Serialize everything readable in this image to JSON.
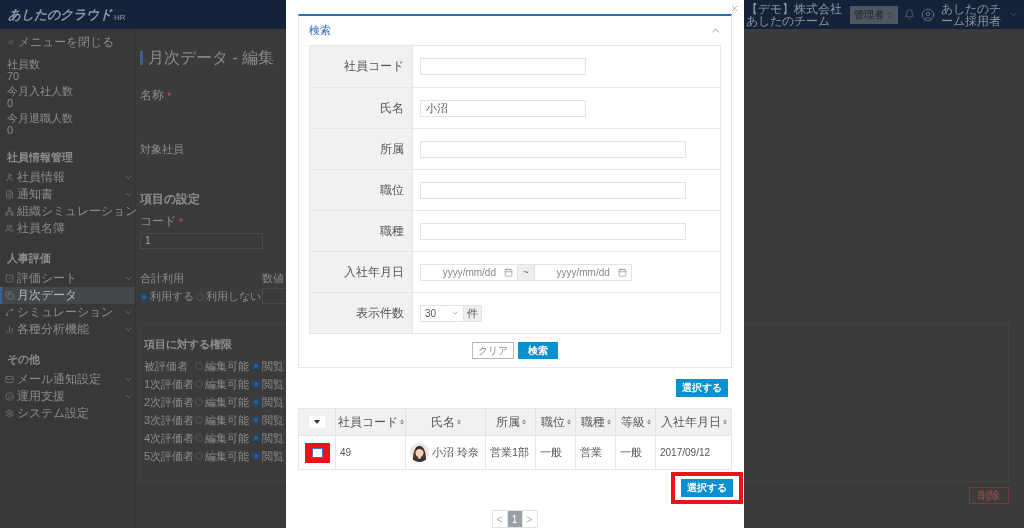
{
  "header": {
    "logo": "あしたのクラウド",
    "logo_suffix": "HR",
    "company": "【デモ】株式会社あしたのチーム",
    "role": "管理者",
    "user": "あしたのチーム採用者"
  },
  "sidebar": {
    "collapse": "メニューを閉じる",
    "stats": [
      {
        "label": "社員数",
        "value": "70"
      },
      {
        "label": "今月入社人数",
        "value": "0"
      },
      {
        "label": "今月退職人数",
        "value": "0"
      }
    ],
    "sections": [
      {
        "title": "社員情報管理",
        "items": [
          {
            "label": "社員情報",
            "expandable": true,
            "selected": false
          },
          {
            "label": "通知書",
            "expandable": true,
            "selected": false
          },
          {
            "label": "組織シミュレーション",
            "expandable": false,
            "selected": false
          },
          {
            "label": "社員名簿",
            "expandable": false,
            "selected": false
          }
        ]
      },
      {
        "title": "人事評価",
        "items": [
          {
            "label": "評価シート",
            "expandable": true,
            "selected": false
          },
          {
            "label": "月次データ",
            "expandable": false,
            "selected": true
          },
          {
            "label": "シミュレーション",
            "expandable": true,
            "selected": false
          },
          {
            "label": "各種分析機能",
            "expandable": true,
            "selected": false
          }
        ]
      },
      {
        "title": "その他",
        "items": [
          {
            "label": "メール通知設定",
            "expandable": true,
            "selected": false
          },
          {
            "label": "運用支援",
            "expandable": true,
            "selected": false
          },
          {
            "label": "システム設定",
            "expandable": false,
            "selected": false
          }
        ]
      }
    ]
  },
  "page": {
    "title": "月次データ - 編集",
    "name_field": {
      "label": "名称",
      "required_mark": "*"
    },
    "target_label": "対象社員",
    "settings_title": "項目の設定",
    "code_field": {
      "label": "コード",
      "required_mark": "*",
      "value": "1"
    },
    "total_label": "合計利用",
    "total_options": [
      {
        "label": "利用する",
        "selected": true
      },
      {
        "label": "利用しない",
        "selected": false
      }
    ],
    "numeric_label": "数値",
    "permissions_title": "項目に対する権限",
    "permissions": [
      {
        "role": "被評価者",
        "options": [
          {
            "label": "編集可能",
            "selected": false
          },
          {
            "label": "閲覧",
            "selected": true
          }
        ]
      },
      {
        "role": "1次評価者",
        "options": [
          {
            "label": "編集可能",
            "selected": false
          },
          {
            "label": "閲覧",
            "selected": true
          }
        ]
      },
      {
        "role": "2次評価者",
        "options": [
          {
            "label": "編集可能",
            "selected": false
          },
          {
            "label": "閲覧",
            "selected": true
          }
        ]
      },
      {
        "role": "3次評価者",
        "options": [
          {
            "label": "編集可能",
            "selected": false
          },
          {
            "label": "閲覧",
            "selected": true
          }
        ]
      },
      {
        "role": "4次評価者",
        "options": [
          {
            "label": "編集可能",
            "selected": false
          },
          {
            "label": "閲覧",
            "selected": true
          }
        ]
      },
      {
        "role": "5次評価者",
        "options": [
          {
            "label": "編集可能",
            "selected": false
          },
          {
            "label": "閲覧",
            "selected": true
          }
        ]
      }
    ],
    "delete_button": "削除"
  },
  "dialog": {
    "search": {
      "title": "検索",
      "expanded": true,
      "fields": [
        {
          "kind": "text",
          "label": "社員コード"
        },
        {
          "kind": "text",
          "label": "氏名",
          "value": "小沼"
        },
        {
          "kind": "text",
          "label": "所属"
        },
        {
          "kind": "text",
          "label": "職位"
        },
        {
          "kind": "text",
          "label": "職種"
        },
        {
          "kind": "date_range",
          "label": "入社年月日",
          "placeholders": [
            "yyyy/mm/dd",
            "yyyy/mm/dd"
          ],
          "separator": "~"
        },
        {
          "kind": "select",
          "label": "表示件数",
          "value": "30",
          "unit": "件"
        }
      ],
      "clear_button": "クリア",
      "search_button": "検索"
    },
    "select_buttons": [
      {
        "label": "選択する",
        "highlighted": false
      },
      {
        "label": "選択する",
        "highlighted": true
      }
    ],
    "table": {
      "columns": [
        {
          "label": "社員コード"
        },
        {
          "label": "氏名"
        },
        {
          "label": "所属"
        },
        {
          "label": "職位"
        },
        {
          "label": "職種"
        },
        {
          "label": "等級"
        },
        {
          "label": "入社年月日"
        }
      ],
      "rows": [
        {
          "checked": false,
          "highlighted": true,
          "cells": [
            "49",
            "小沼 玲奈",
            "営業1部",
            "一般",
            "営業",
            "一般",
            "2017/09/12"
          ]
        }
      ]
    },
    "pagination": {
      "prev": "<",
      "pages": [
        {
          "label": "1",
          "selected": true
        }
      ],
      "next": ">"
    }
  }
}
